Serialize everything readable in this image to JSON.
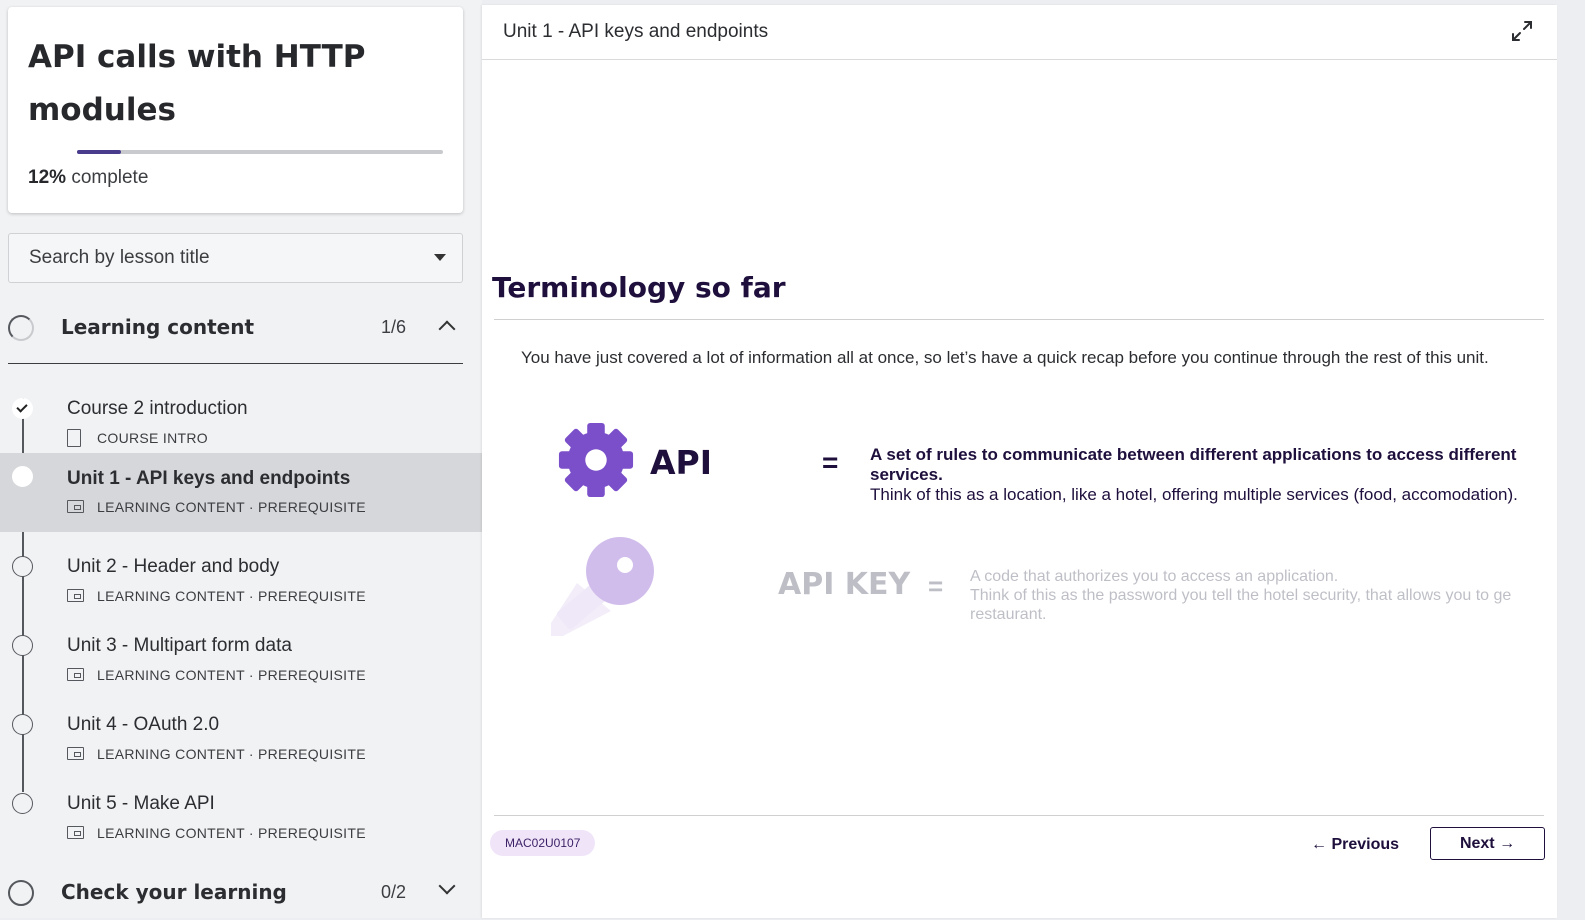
{
  "course": {
    "title": "API calls with HTTP modules",
    "progress_percent_value": 12,
    "progress_percent": "12%",
    "progress_suffix": "complete"
  },
  "search": {
    "placeholder": "Search by lesson title"
  },
  "sections": [
    {
      "label": "Learning content",
      "count": "1/6",
      "expanded": true
    },
    {
      "label": "Check your learning",
      "count": "0/2",
      "expanded": false
    }
  ],
  "lessons": [
    {
      "title": "Course 2 introduction",
      "meta": "COURSE INTRO",
      "icon": "document-icon",
      "status": "completed"
    },
    {
      "title": "Unit 1 - API keys and endpoints",
      "meta": "LEARNING CONTENT · PREREQUISITE",
      "icon": "slides-icon",
      "status": "active"
    },
    {
      "title": "Unit 2 - Header and body",
      "meta": "LEARNING CONTENT · PREREQUISITE",
      "icon": "slides-icon",
      "status": "not-started"
    },
    {
      "title": "Unit 3 - Multipart form data",
      "meta": "LEARNING CONTENT · PREREQUISITE",
      "icon": "slides-icon",
      "status": "not-started"
    },
    {
      "title": "Unit 4 - OAuth 2.0",
      "meta": "LEARNING CONTENT · PREREQUISITE",
      "icon": "slides-icon",
      "status": "not-started"
    },
    {
      "title": "Unit 5 - Make API",
      "meta": "LEARNING CONTENT · PREREQUISITE",
      "icon": "slides-icon",
      "status": "not-started"
    }
  ],
  "main": {
    "header_title": "Unit 1 - API keys and endpoints",
    "expand_icon": "expand-icon",
    "slide": {
      "heading": "Terminology so far",
      "intro": "You have just covered a lot of information all at once, so let’s have a quick recap before you continue through the rest of this unit.",
      "terms": [
        {
          "icon": "gear-icon",
          "term": "API",
          "equals": "=",
          "definition_bold": "A set of rules to communicate between different applications to access different services.",
          "definition": "Think of this as a location, like a hotel, offering multiple services (food, accomodation)."
        },
        {
          "icon": "key-icon",
          "term": "API KEY",
          "equals": "=",
          "definition_line1": "A code that authorizes you to access an application.",
          "definition_line2": "Think of this as the password you tell the hotel security, that allows you to ge",
          "definition_line3": "restaurant."
        }
      ]
    },
    "footer": {
      "badge": "MAC02U0107",
      "prev_label": "← Previous",
      "next_label": "Next →"
    }
  },
  "colors": {
    "accent_purple": "#7b4fc9",
    "dark_navy": "#1e0f3c",
    "badge_bg": "#f0e5f8",
    "active_row": "#d6d7da"
  }
}
